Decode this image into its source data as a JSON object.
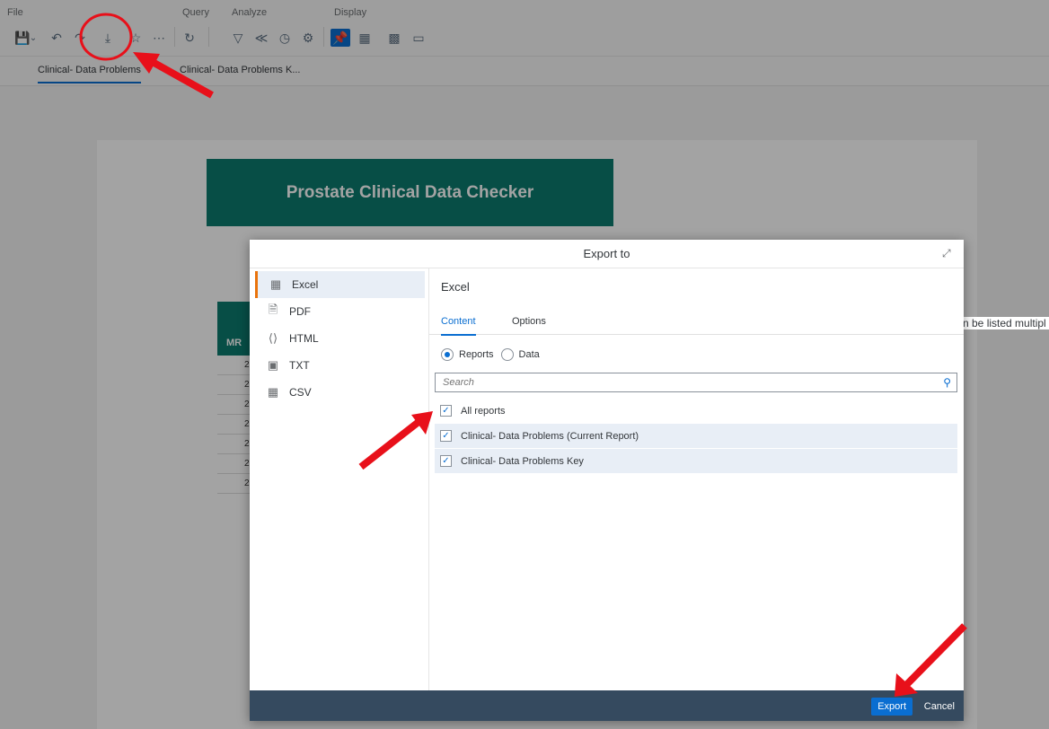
{
  "toolbar": {
    "groups": [
      "File",
      "Query",
      "Analyze",
      "Display"
    ],
    "icons": [
      "save-icon",
      "undo-icon",
      "redo-icon",
      "download-icon",
      "star-icon",
      "more-icon",
      "refresh-icon",
      "filter-icon",
      "collapse-icon",
      "history-icon",
      "settings-icon",
      "pin-icon",
      "panel-icon",
      "layout-icon",
      "screen-icon"
    ]
  },
  "tabs": [
    "Clinical- Data Problems",
    "Clinical- Data Problems K..."
  ],
  "report": {
    "banner": "Prostate Clinical Data Checker",
    "table_header": "MR",
    "row_values": [
      "2",
      "2",
      "2",
      "2",
      "2",
      "2",
      "2"
    ],
    "side_note": "n be listed multipl"
  },
  "dialog": {
    "title": "Export to",
    "formats": [
      "Excel",
      "PDF",
      "HTML",
      "TXT",
      "CSV"
    ],
    "selected_format": "Excel",
    "pane_title": "Excel",
    "content_tabs": [
      "Content",
      "Options"
    ],
    "radios": [
      "Reports",
      "Data"
    ],
    "selected_radio": "Reports",
    "search_placeholder": "Search",
    "reports": [
      {
        "label": "All reports",
        "checked": true
      },
      {
        "label": "Clinical- Data Problems (Current Report)",
        "checked": true
      },
      {
        "label": "Clinical- Data Problems Key",
        "checked": true
      }
    ],
    "export_label": "Export",
    "cancel_label": "Cancel"
  },
  "colors": {
    "accent": "#0a6ed1",
    "banner": "#0b7a6e",
    "footer": "#354a5f",
    "annotation": "#e8101a"
  }
}
